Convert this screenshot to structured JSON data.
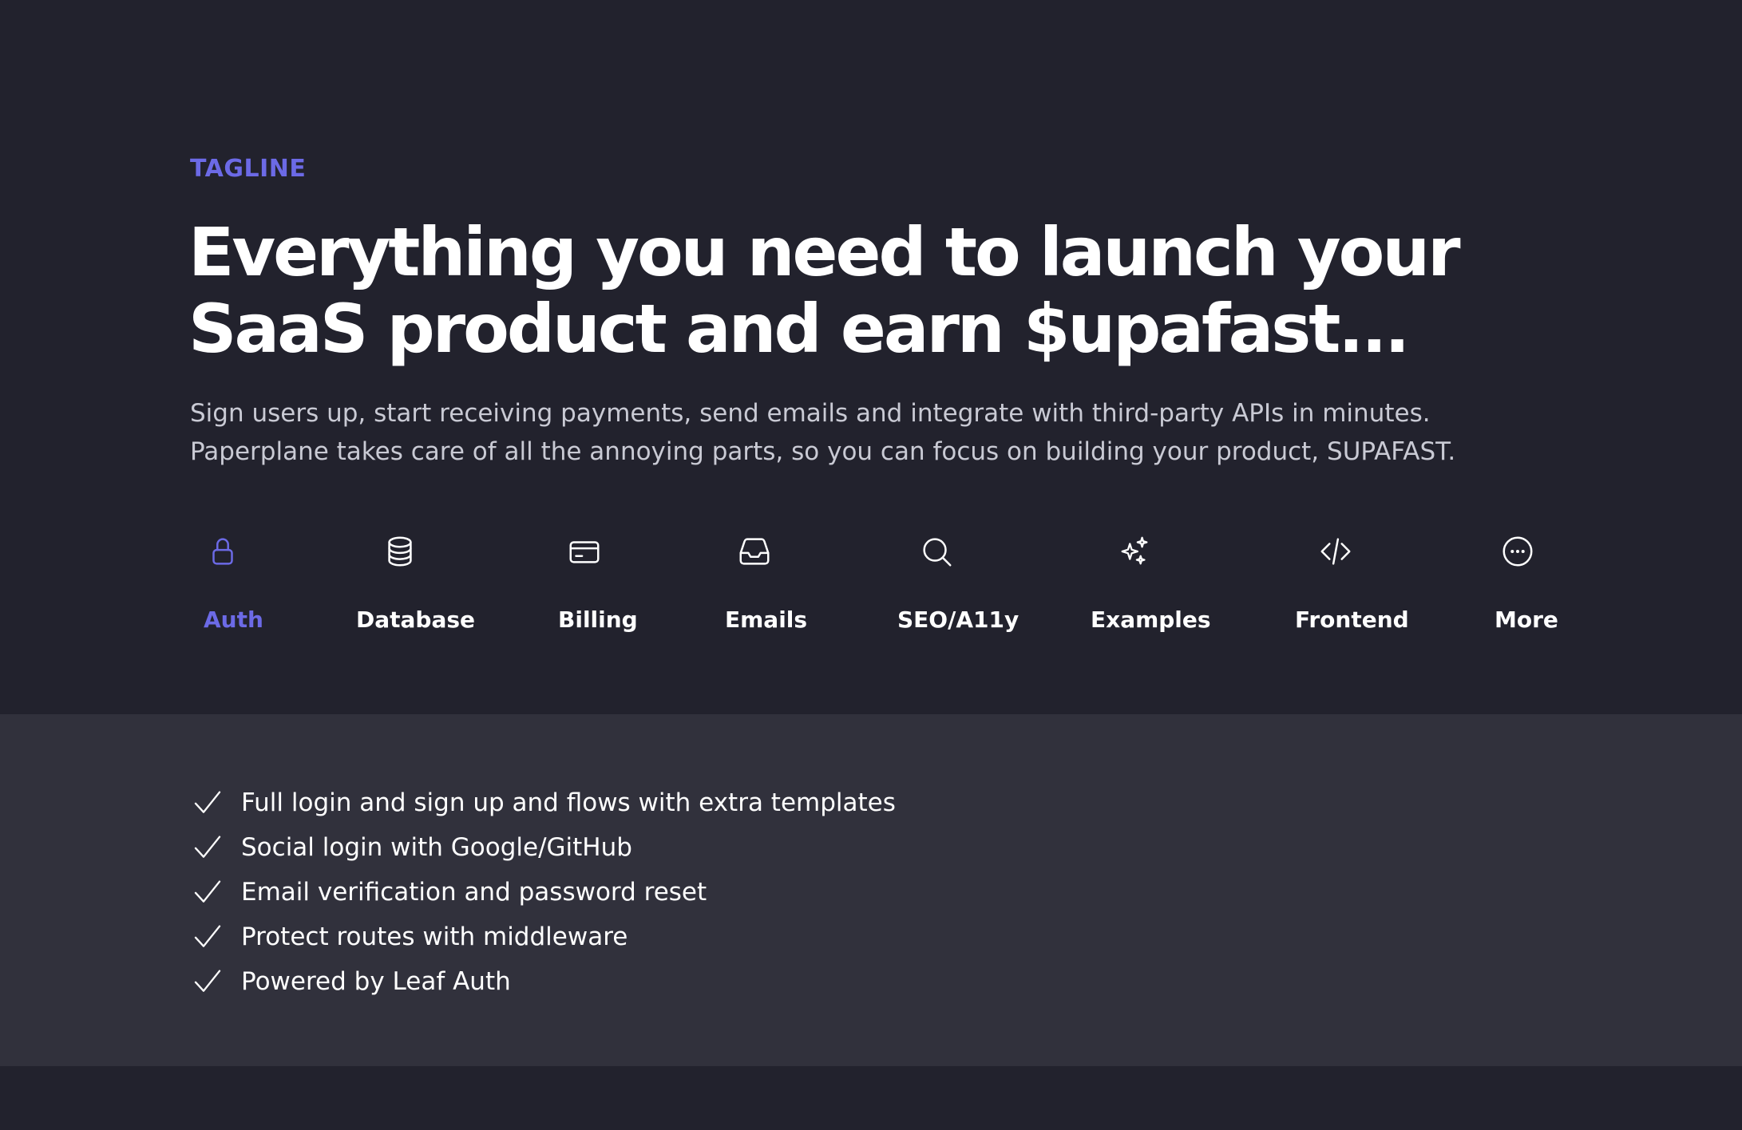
{
  "hero": {
    "tagline": "TAGLINE",
    "headline_line1": "Everything you need to launch your",
    "headline_line2": "SaaS product and earn $upafast...",
    "subtext_line1": "Sign users up, start receiving payments, send emails and integrate with third-party APIs in minutes.",
    "subtext_line2": "Paperplane takes care of all the annoying parts, so you can focus on building your product, SUPAFAST."
  },
  "tabs": [
    {
      "label": "Auth",
      "icon": "lock-icon",
      "active": true
    },
    {
      "label": "Database",
      "icon": "database-icon",
      "active": false
    },
    {
      "label": "Billing",
      "icon": "credit-card-icon",
      "active": false
    },
    {
      "label": "Emails",
      "icon": "inbox-icon",
      "active": false
    },
    {
      "label": "SEO/A11y",
      "icon": "search-icon",
      "active": false
    },
    {
      "label": "Examples",
      "icon": "sparkles-icon",
      "active": false
    },
    {
      "label": "Frontend",
      "icon": "code-icon",
      "active": false
    },
    {
      "label": "More",
      "icon": "more-circle-icon",
      "active": false
    }
  ],
  "features": [
    "Full login and sign up and flows with extra templates",
    "Social login with Google/GitHub",
    "Email verification and password reset",
    "Protect routes with middleware",
    "Powered by Leaf Auth"
  ],
  "colors": {
    "background": "#22222d",
    "panel": "#31313c",
    "accent": "#6c6ae6",
    "text": "#ffffff",
    "muted_text": "#c9cad4"
  }
}
